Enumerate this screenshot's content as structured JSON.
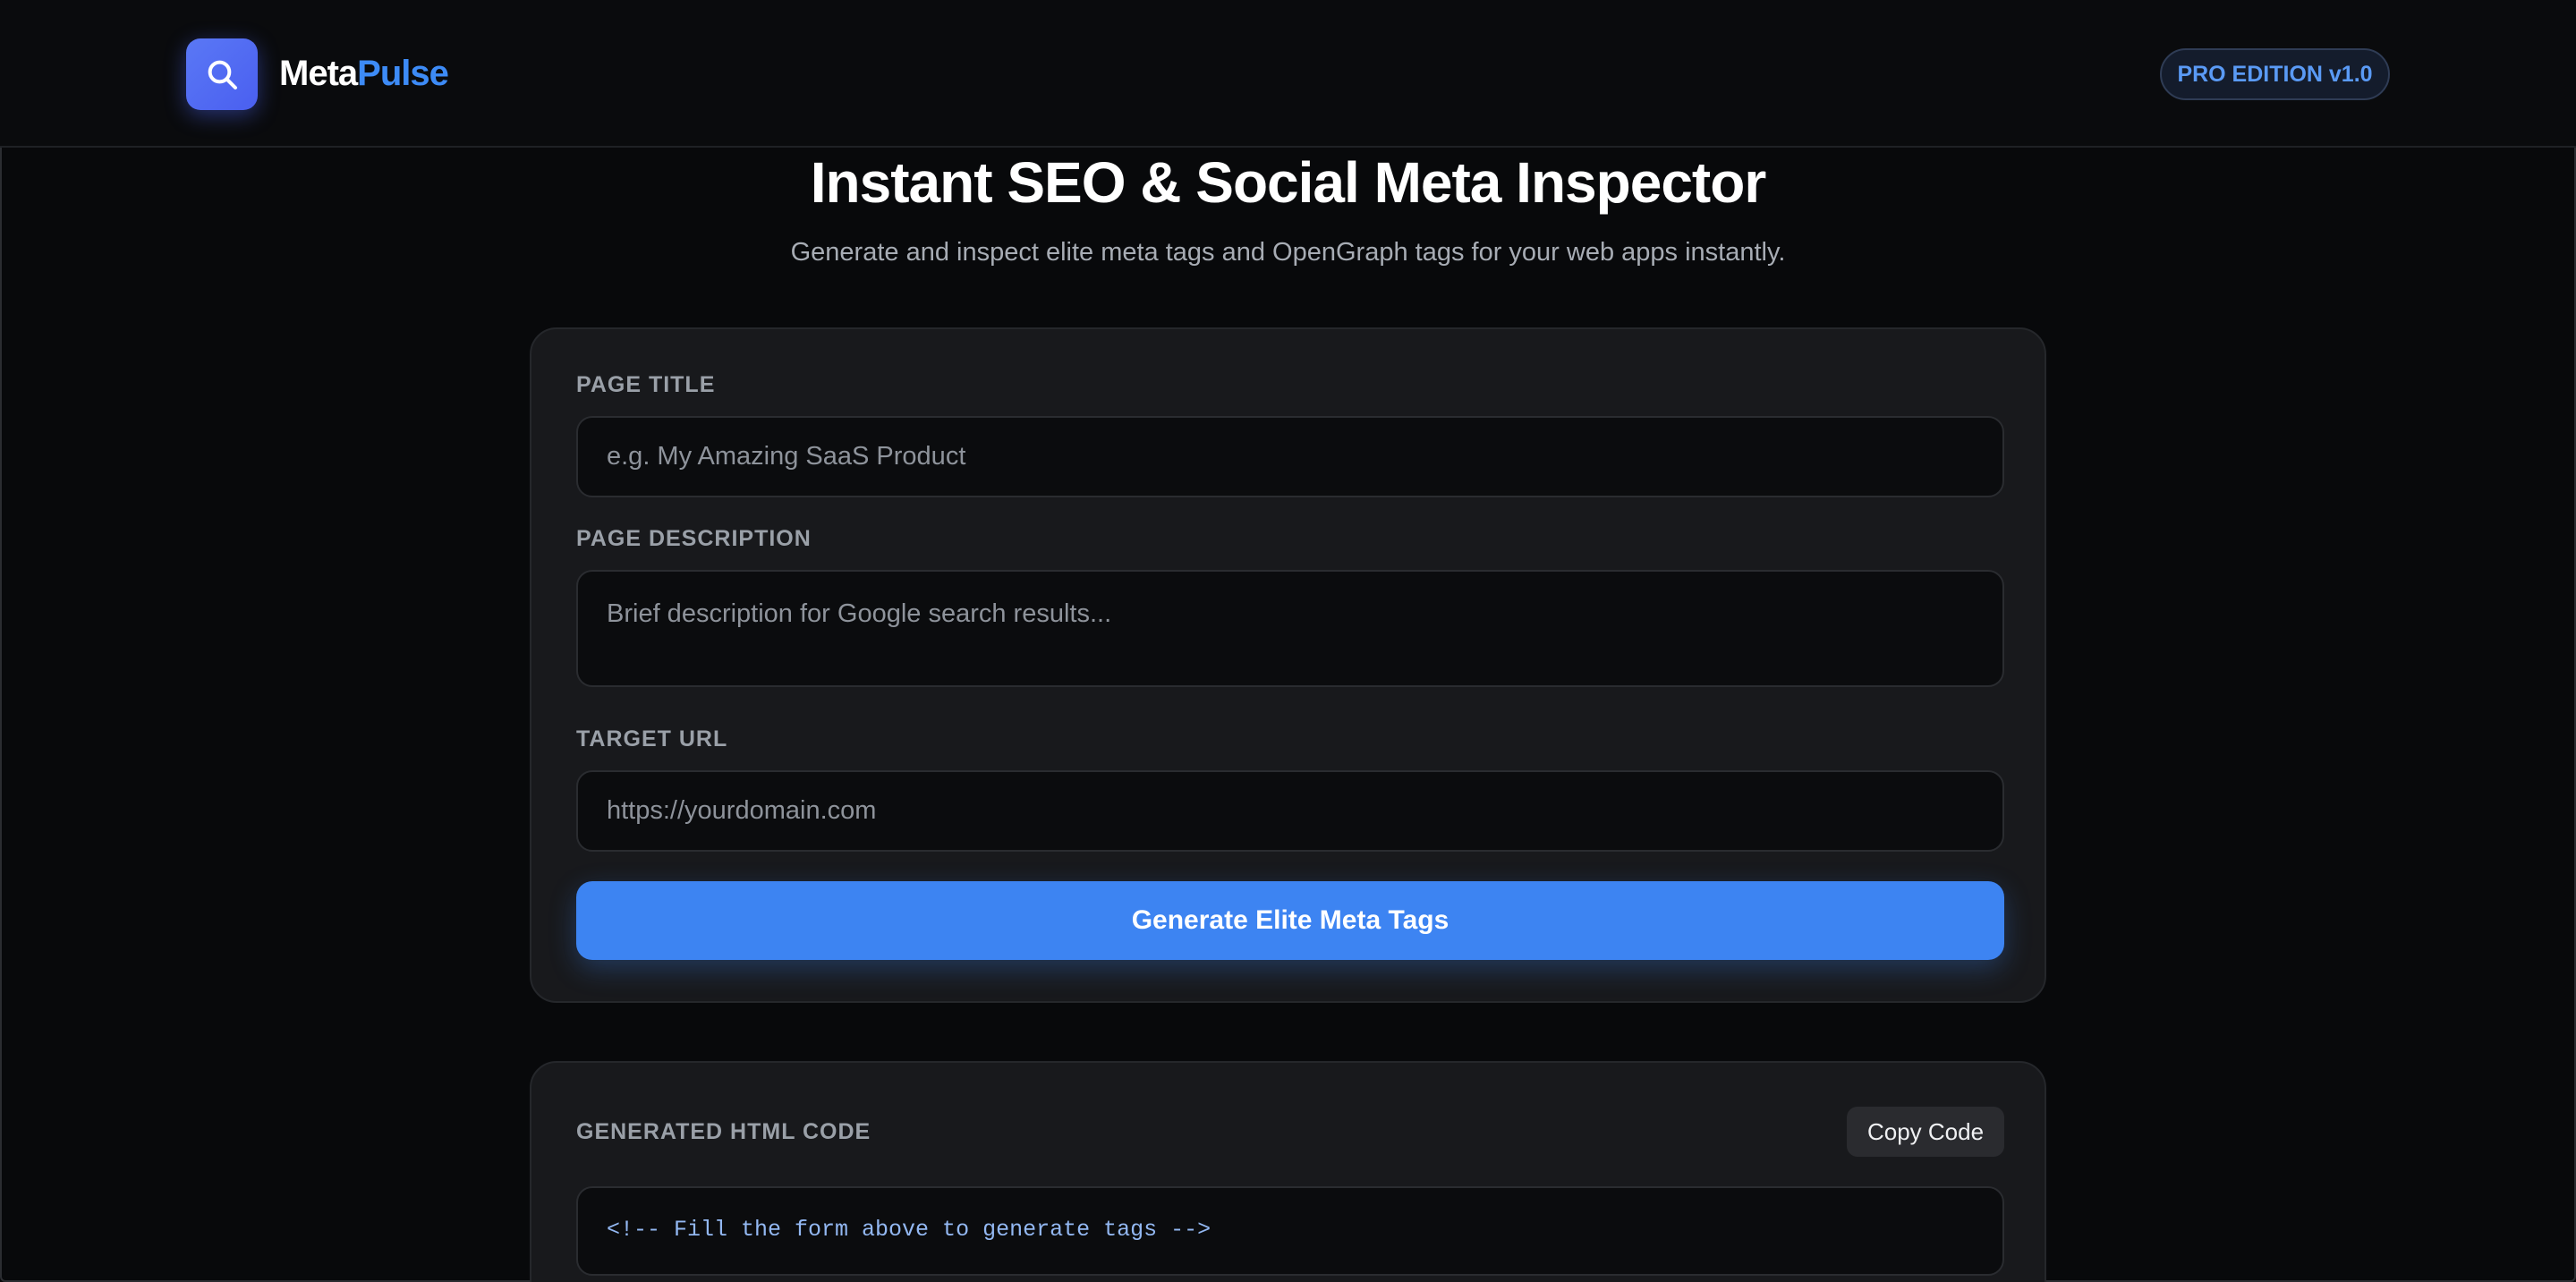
{
  "header": {
    "logo_icon": "search-icon",
    "brand_part1": "Meta",
    "brand_part2": "Pulse",
    "badge": "PRO EDITION v1.0"
  },
  "hero": {
    "title": "Instant SEO & Social Meta Inspector",
    "subtitle": "Generate and inspect elite meta tags and OpenGraph tags for your web apps instantly."
  },
  "form": {
    "title_label": "PAGE TITLE",
    "title_placeholder": "e.g. My Amazing SaaS Product",
    "title_value": "",
    "description_label": "PAGE DESCRIPTION",
    "description_placeholder": "Brief description for Google search results...",
    "description_value": "",
    "url_label": "TARGET URL",
    "url_placeholder": "https://yourdomain.com",
    "url_value": "",
    "generate_button": "Generate Elite Meta Tags"
  },
  "output": {
    "label": "GENERATED HTML CODE",
    "copy_button": "Copy Code",
    "code": "<!-- Fill the form above to generate tags -->"
  },
  "colors": {
    "background": "#08090b",
    "card": "#18191c",
    "accent": "#3d84f2",
    "logo_gradient_start": "#5a78f5",
    "logo_gradient_end": "#4a5ff0",
    "badge_text": "#5a9af5"
  }
}
